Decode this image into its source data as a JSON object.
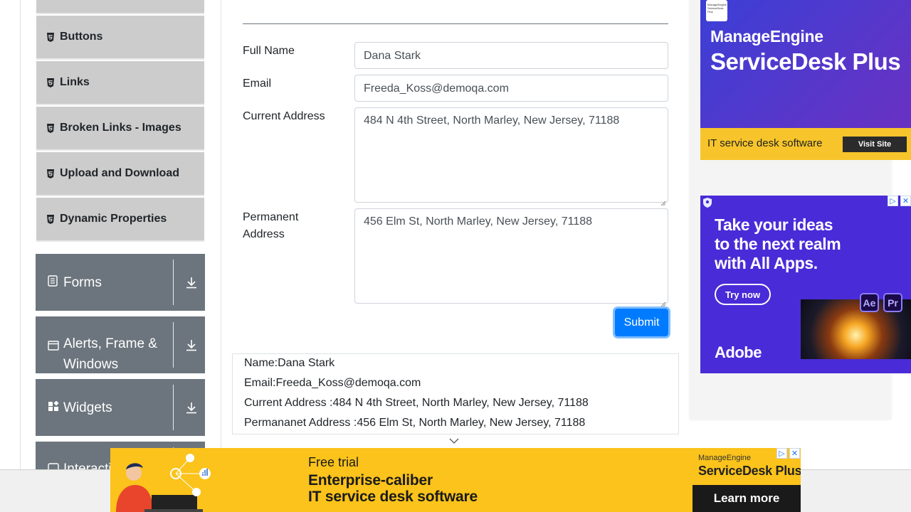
{
  "sidebar": {
    "elements_items": [
      {
        "label": "Buttons"
      },
      {
        "label": "Links"
      },
      {
        "label": "Broken Links - Images"
      },
      {
        "label": "Upload and Download"
      },
      {
        "label": "Dynamic Properties"
      }
    ],
    "groups": [
      {
        "label": "Forms",
        "icon": "form-icon"
      },
      {
        "label": "Alerts, Frame & Windows",
        "icon": "window-icon"
      },
      {
        "label": "Widgets",
        "icon": "widgets-icon"
      },
      {
        "label": "Interactions",
        "icon": "interactions-icon"
      }
    ]
  },
  "form": {
    "full_name": {
      "label": "Full Name",
      "value": "Dana Stark"
    },
    "email": {
      "label": "Email",
      "value": "Freeda_Koss@demoqa.com"
    },
    "current_address": {
      "label": "Current Address",
      "value": "484 N 4th Street, North Marley, New Jersey, 71188"
    },
    "permanent_address": {
      "label_line1": "Permanent",
      "label_line2": "Address",
      "value": "456 Elm St, North Marley, New Jersey, 71188"
    },
    "submit_label": "Submit"
  },
  "output": {
    "name": "Name:Dana Stark",
    "email": "Email:Freeda_Koss@demoqa.com",
    "current_address": "Current Address :484 N 4th Street, North Marley, New Jersey, 71188",
    "permanent_address": "Permananet Address :456 Elm St, North Marley, New Jersey, 71188"
  },
  "ads": {
    "top": {
      "brand": "ManageEngine",
      "product": "ServiceDesk Plus",
      "strip_text": "IT service desk software",
      "cta": "Visit Site"
    },
    "middle": {
      "headline_1": "Take your ideas",
      "headline_2": "to the next realm",
      "headline_3": "with All Apps.",
      "cta": "Try now",
      "brand": "Adobe",
      "app1": "Ae",
      "app2": "Pr"
    },
    "bottom": {
      "line1": "Free trial",
      "line2": "Enterprise-caliber",
      "line3": "IT service desk software",
      "brand": "ManageEngine",
      "product": "ServiceDesk Plus",
      "cta": "Learn more"
    }
  },
  "colors": {
    "primary": "#007bff",
    "group_bg": "#6c757d",
    "sub_item_bg": "#cccccc",
    "ad_yellow": "#fbc31b"
  }
}
